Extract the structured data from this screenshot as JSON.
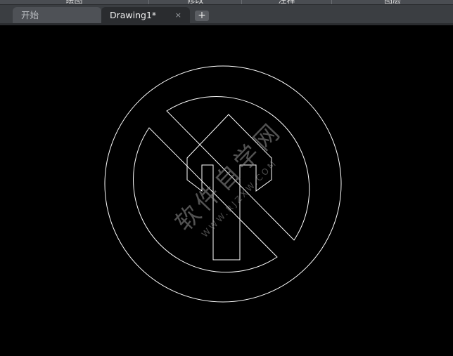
{
  "ribbon": {
    "sections": [
      "绘图",
      "修改",
      "注释",
      "图层"
    ]
  },
  "tabs": {
    "start_label": "开始",
    "drawing_label": "Drawing1*",
    "close_glyph": "×",
    "new_glyph": "+"
  },
  "canvas": {
    "background": "#000000",
    "line_color": "#ffffff"
  },
  "watermark": {
    "text": "软件自学网",
    "sub_text": "WWW.RJZXW.COM"
  }
}
